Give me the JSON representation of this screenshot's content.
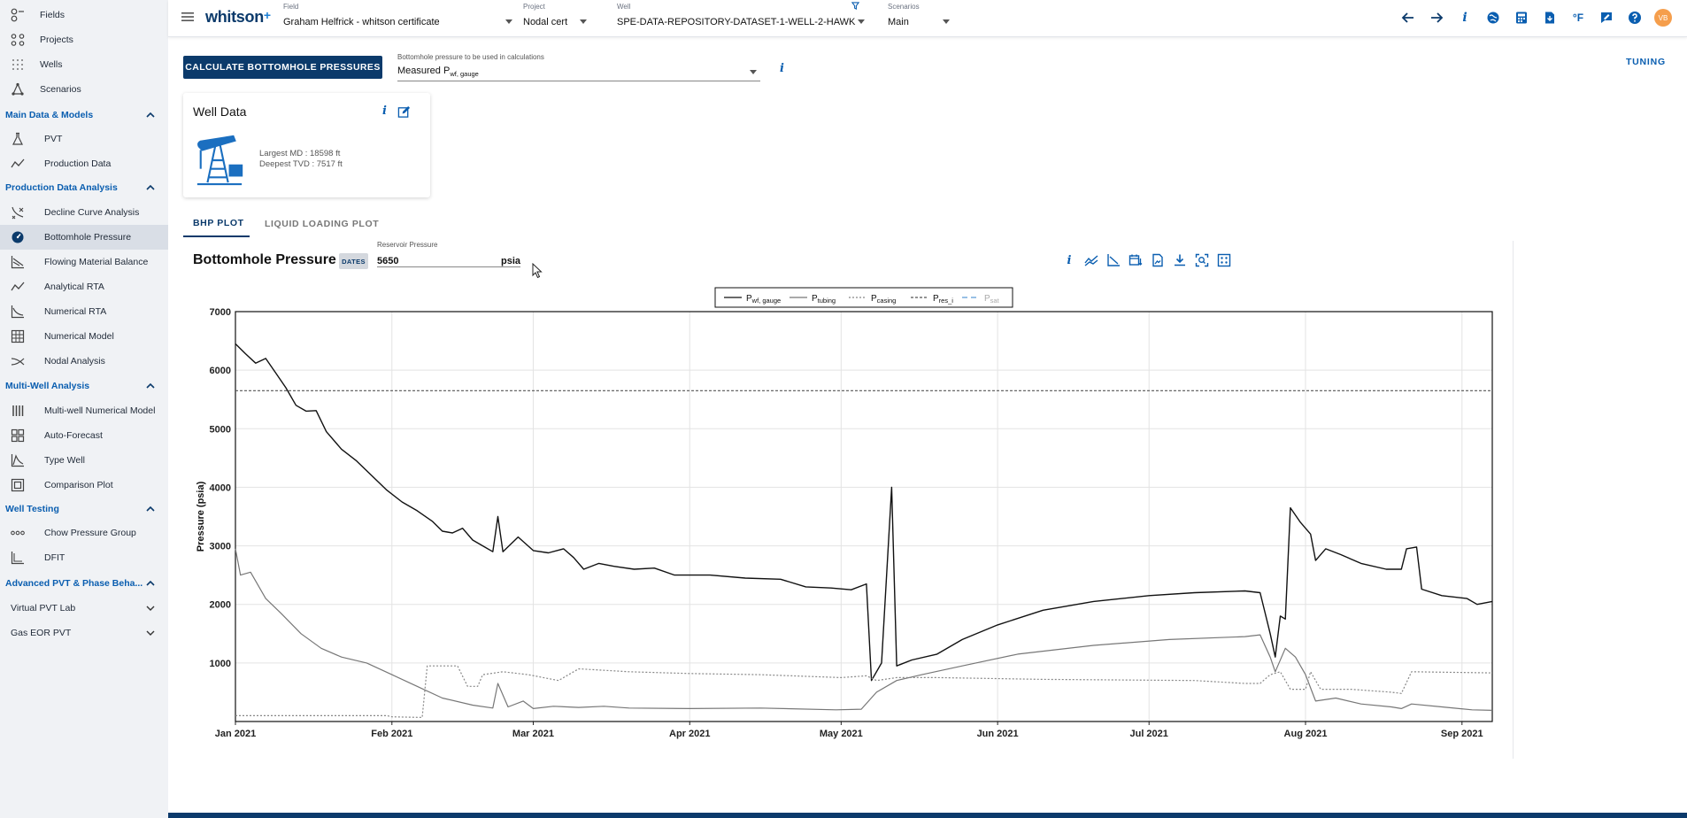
{
  "sidebar": {
    "top_items": [
      {
        "label": "Fields",
        "icon": "fields-icon"
      },
      {
        "label": "Projects",
        "icon": "projects-icon"
      },
      {
        "label": "Wells",
        "icon": "wells-icon"
      },
      {
        "label": "Scenarios",
        "icon": "scenarios-icon"
      }
    ],
    "sections": [
      {
        "label": "Main Data & Models",
        "items": [
          {
            "label": "PVT",
            "icon": "flask-icon"
          },
          {
            "label": "Production Data",
            "icon": "trend-icon"
          }
        ]
      },
      {
        "label": "Production Data Analysis",
        "items": [
          {
            "label": "Decline Curve Analysis",
            "icon": "decline-icon"
          },
          {
            "label": "Bottomhole Pressure",
            "icon": "gauge-icon",
            "active": true
          },
          {
            "label": "Flowing Material Balance",
            "icon": "fmb-icon"
          },
          {
            "label": "Analytical RTA",
            "icon": "trend-icon"
          },
          {
            "label": "Numerical RTA",
            "icon": "numerical-rta-icon"
          },
          {
            "label": "Numerical Model",
            "icon": "grid-icon"
          },
          {
            "label": "Nodal Analysis",
            "icon": "nodal-icon"
          }
        ]
      },
      {
        "label": "Multi-Well Analysis",
        "items": [
          {
            "label": "Multi-well Numerical Model",
            "icon": "bars-icon"
          },
          {
            "label": "Auto-Forecast",
            "icon": "tiles-icon"
          },
          {
            "label": "Type Well",
            "icon": "type-well-icon"
          },
          {
            "label": "Comparison Plot",
            "icon": "comparison-icon"
          }
        ]
      },
      {
        "label": "Well Testing",
        "items": [
          {
            "label": "Chow Pressure Group",
            "icon": "dots-icon"
          },
          {
            "label": "DFIT",
            "icon": "dfit-icon"
          }
        ]
      },
      {
        "label": "Advanced PVT & Phase Beha...",
        "items": []
      }
    ],
    "groups": [
      {
        "label": "Virtual PVT Lab"
      },
      {
        "label": "Gas EOR PVT"
      }
    ]
  },
  "topbar": {
    "logo": "whitson",
    "logo_plus": "+",
    "field": {
      "caption": "Field",
      "value": "Graham Helfrick - whitson certificate"
    },
    "project": {
      "caption": "Project",
      "value": "Nodal cert"
    },
    "well": {
      "caption": "Well",
      "value": "SPE-DATA-REPOSITORY-DATASET-1-WELL-2-HAWK"
    },
    "scenarios": {
      "caption": "Scenarios",
      "value": "Main"
    },
    "avatar": "VB",
    "units_label": "°F"
  },
  "main": {
    "calc_button": "CALCULATE BOTTOMHOLE PRESSURES",
    "bhp_select": {
      "caption": "Bottomhole pressure to be used in calculations",
      "value": "Measured P",
      "value_sub": "wf, gauge"
    },
    "tuning": "TUNING",
    "info_glyph": "i",
    "well_card": {
      "title": "Well Data",
      "largest_md": "Largest MD :  18598 ft",
      "deepest_tvd": "Deepest TVD :  7517 ft"
    },
    "tabs": [
      {
        "label": "BHP PLOT",
        "active": true
      },
      {
        "label": "LIQUID LOADING PLOT",
        "active": false
      }
    ],
    "chart_header": {
      "title": "Bottomhole Pressure",
      "dates_badge": "DATES",
      "reservoir": {
        "caption": "Reservoir Pressure",
        "value": "5650",
        "unit": "psia"
      }
    }
  },
  "chart_data": {
    "type": "line",
    "ylabel": "Pressure (psia)",
    "xlabel": "",
    "ylim": [
      0,
      7000
    ],
    "yticks": [
      1000,
      2000,
      3000,
      4000,
      5000,
      6000,
      7000
    ],
    "xlim": [
      "2021-01-01",
      "2021-09-07"
    ],
    "xticks": [
      {
        "date": "2021-01-01",
        "label": "Jan 2021"
      },
      {
        "date": "2021-02-01",
        "label": "Feb 2021"
      },
      {
        "date": "2021-03-01",
        "label": "Mar 2021"
      },
      {
        "date": "2021-04-01",
        "label": "Apr 2021"
      },
      {
        "date": "2021-05-01",
        "label": "May 2021"
      },
      {
        "date": "2021-06-01",
        "label": "Jun 2021"
      },
      {
        "date": "2021-07-01",
        "label": "Jul 2021"
      },
      {
        "date": "2021-08-01",
        "label": "Aug 2021"
      },
      {
        "date": "2021-09-01",
        "label": "Sep 2021"
      }
    ],
    "grid": true,
    "legend_position": "top",
    "series": [
      {
        "name": "P",
        "name_sub": "wf, gauge",
        "color": "#111111",
        "dash": "",
        "points": [
          [
            "2021-01-01",
            6450
          ],
          [
            "2021-01-03",
            6280
          ],
          [
            "2021-01-05",
            6120
          ],
          [
            "2021-01-07",
            6200
          ],
          [
            "2021-01-09",
            5950
          ],
          [
            "2021-01-11",
            5700
          ],
          [
            "2021-01-13",
            5400
          ],
          [
            "2021-01-15",
            5300
          ],
          [
            "2021-01-17",
            5310
          ],
          [
            "2021-01-19",
            4950
          ],
          [
            "2021-01-22",
            4650
          ],
          [
            "2021-01-25",
            4450
          ],
          [
            "2021-01-28",
            4200
          ],
          [
            "2021-01-31",
            3950
          ],
          [
            "2021-02-03",
            3750
          ],
          [
            "2021-02-06",
            3600
          ],
          [
            "2021-02-09",
            3420
          ],
          [
            "2021-02-11",
            3250
          ],
          [
            "2021-02-13",
            3220
          ],
          [
            "2021-02-15",
            3300
          ],
          [
            "2021-02-17",
            3100
          ],
          [
            "2021-02-19",
            3000
          ],
          [
            "2021-02-21",
            2900
          ],
          [
            "2021-02-22",
            3500
          ],
          [
            "2021-02-23",
            2900
          ],
          [
            "2021-02-26",
            3150
          ],
          [
            "2021-03-01",
            2920
          ],
          [
            "2021-03-04",
            2880
          ],
          [
            "2021-03-07",
            2950
          ],
          [
            "2021-03-09",
            2800
          ],
          [
            "2021-03-11",
            2600
          ],
          [
            "2021-03-14",
            2700
          ],
          [
            "2021-03-17",
            2650
          ],
          [
            "2021-03-21",
            2600
          ],
          [
            "2021-03-25",
            2620
          ],
          [
            "2021-03-29",
            2500
          ],
          [
            "2021-04-05",
            2500
          ],
          [
            "2021-04-12",
            2450
          ],
          [
            "2021-04-19",
            2430
          ],
          [
            "2021-04-24",
            2300
          ],
          [
            "2021-04-29",
            2280
          ],
          [
            "2021-05-03",
            2250
          ],
          [
            "2021-05-06",
            2350
          ],
          [
            "2021-05-07",
            700
          ],
          [
            "2021-05-09",
            1000
          ],
          [
            "2021-05-11",
            4000
          ],
          [
            "2021-05-12",
            950
          ],
          [
            "2021-05-15",
            1050
          ],
          [
            "2021-05-20",
            1150
          ],
          [
            "2021-05-25",
            1400
          ],
          [
            "2021-06-01",
            1650
          ],
          [
            "2021-06-10",
            1900
          ],
          [
            "2021-06-20",
            2050
          ],
          [
            "2021-07-01",
            2150
          ],
          [
            "2021-07-10",
            2200
          ],
          [
            "2021-07-20",
            2230
          ],
          [
            "2021-07-23",
            2200
          ],
          [
            "2021-07-25",
            1500
          ],
          [
            "2021-07-26",
            1100
          ],
          [
            "2021-07-27",
            1800
          ],
          [
            "2021-07-28",
            1750
          ],
          [
            "2021-07-29",
            3650
          ],
          [
            "2021-07-31",
            3400
          ],
          [
            "2021-08-02",
            3200
          ],
          [
            "2021-08-03",
            2750
          ],
          [
            "2021-08-05",
            2950
          ],
          [
            "2021-08-08",
            2850
          ],
          [
            "2021-08-12",
            2700
          ],
          [
            "2021-08-17",
            2600
          ],
          [
            "2021-08-20",
            2600
          ],
          [
            "2021-08-21",
            2950
          ],
          [
            "2021-08-23",
            2980
          ],
          [
            "2021-08-24",
            2260
          ],
          [
            "2021-08-28",
            2150
          ],
          [
            "2021-09-02",
            2100
          ],
          [
            "2021-09-04",
            2000
          ],
          [
            "2021-09-07",
            2050
          ]
        ]
      },
      {
        "name": "P",
        "name_sub": "tubing",
        "color": "#777777",
        "dash": "",
        "points": [
          [
            "2021-01-01",
            2950
          ],
          [
            "2021-01-02",
            2500
          ],
          [
            "2021-01-04",
            2550
          ],
          [
            "2021-01-07",
            2100
          ],
          [
            "2021-01-10",
            1850
          ],
          [
            "2021-01-14",
            1500
          ],
          [
            "2021-01-18",
            1250
          ],
          [
            "2021-01-22",
            1100
          ],
          [
            "2021-01-27",
            1000
          ],
          [
            "2021-02-01",
            800
          ],
          [
            "2021-02-06",
            600
          ],
          [
            "2021-02-11",
            400
          ],
          [
            "2021-02-17",
            280
          ],
          [
            "2021-02-21",
            230
          ],
          [
            "2021-02-22",
            650
          ],
          [
            "2021-02-24",
            250
          ],
          [
            "2021-02-27",
            350
          ],
          [
            "2021-03-01",
            220
          ],
          [
            "2021-03-05",
            260
          ],
          [
            "2021-03-10",
            240
          ],
          [
            "2021-03-15",
            260
          ],
          [
            "2021-03-20",
            230
          ],
          [
            "2021-04-01",
            220
          ],
          [
            "2021-04-15",
            230
          ],
          [
            "2021-04-30",
            200
          ],
          [
            "2021-05-05",
            210
          ],
          [
            "2021-05-08",
            500
          ],
          [
            "2021-05-12",
            700
          ],
          [
            "2021-05-17",
            800
          ],
          [
            "2021-05-25",
            950
          ],
          [
            "2021-06-05",
            1150
          ],
          [
            "2021-06-20",
            1300
          ],
          [
            "2021-07-05",
            1400
          ],
          [
            "2021-07-20",
            1450
          ],
          [
            "2021-07-23",
            1480
          ],
          [
            "2021-07-25",
            1100
          ],
          [
            "2021-07-26",
            850
          ],
          [
            "2021-07-28",
            1250
          ],
          [
            "2021-07-30",
            1100
          ],
          [
            "2021-08-01",
            800
          ],
          [
            "2021-08-03",
            350
          ],
          [
            "2021-08-07",
            400
          ],
          [
            "2021-08-12",
            300
          ],
          [
            "2021-08-18",
            250
          ],
          [
            "2021-08-20",
            220
          ],
          [
            "2021-08-22",
            300
          ],
          [
            "2021-08-28",
            250
          ],
          [
            "2021-09-03",
            200
          ],
          [
            "2021-09-07",
            190
          ]
        ]
      },
      {
        "name": "P",
        "name_sub": "casing",
        "color": "#888888",
        "dash": "2,2",
        "points": [
          [
            "2021-01-01",
            100
          ],
          [
            "2021-01-15",
            100
          ],
          [
            "2021-01-31",
            100
          ],
          [
            "2021-02-01",
            80
          ],
          [
            "2021-02-07",
            70
          ],
          [
            "2021-02-08",
            950
          ],
          [
            "2021-02-14",
            950
          ],
          [
            "2021-02-16",
            600
          ],
          [
            "2021-02-18",
            600
          ],
          [
            "2021-02-19",
            800
          ],
          [
            "2021-02-23",
            850
          ],
          [
            "2021-02-28",
            800
          ],
          [
            "2021-03-06",
            700
          ],
          [
            "2021-03-10",
            900
          ],
          [
            "2021-03-20",
            850
          ],
          [
            "2021-04-01",
            820
          ],
          [
            "2021-04-15",
            800
          ],
          [
            "2021-05-01",
            750
          ],
          [
            "2021-05-06",
            780
          ],
          [
            "2021-05-08",
            700
          ],
          [
            "2021-05-12",
            750
          ],
          [
            "2021-05-20",
            750
          ],
          [
            "2021-06-10",
            720
          ],
          [
            "2021-07-10",
            700
          ],
          [
            "2021-07-20",
            650
          ],
          [
            "2021-07-23",
            650
          ],
          [
            "2021-07-25",
            800
          ],
          [
            "2021-07-27",
            850
          ],
          [
            "2021-07-29",
            550
          ],
          [
            "2021-08-01",
            550
          ],
          [
            "2021-08-02",
            850
          ],
          [
            "2021-08-04",
            550
          ],
          [
            "2021-08-10",
            550
          ],
          [
            "2021-08-18",
            500
          ],
          [
            "2021-08-20",
            480
          ],
          [
            "2021-08-22",
            850
          ],
          [
            "2021-09-07",
            830
          ]
        ]
      },
      {
        "name": "P",
        "name_sub": "res_i",
        "color": "#555555",
        "dash": "3,2",
        "points": [
          [
            "2021-01-01",
            5650
          ],
          [
            "2021-09-07",
            5650
          ]
        ]
      },
      {
        "name": "P",
        "name_sub": "sat",
        "color": "#5a9bd5",
        "dash": "6,4",
        "points": []
      }
    ]
  }
}
